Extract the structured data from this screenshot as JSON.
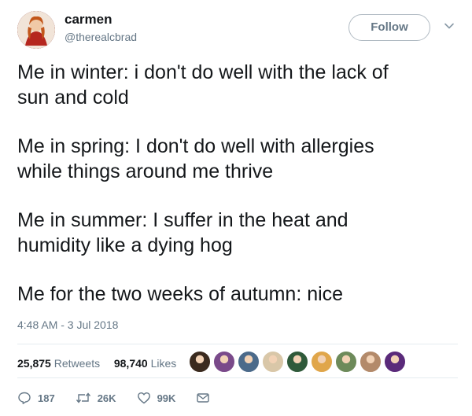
{
  "user": {
    "display_name": "carmen",
    "handle": "@therealcbrad",
    "follow_label": "Follow"
  },
  "tweet": {
    "lines": [
      "Me in winter: i don't do well with the lack of\nsun and cold",
      "Me in spring: I don't do well with allergies\nwhile things around me thrive",
      "Me in summer: I suffer in the heat and\nhumidity like a dying hog",
      "Me for the two weeks of autumn: nice"
    ],
    "timestamp": "4:48 AM - 3 Jul 2018"
  },
  "stats": {
    "retweets_count": "25,875",
    "retweets_label": "Retweets",
    "likes_count": "98,740",
    "likes_label": "Likes"
  },
  "liker_avatar_colors": [
    "#3a2a1e",
    "#7a4a8a",
    "#4b6a8a",
    "#d9c7a8",
    "#2f5a3a",
    "#e0a64a",
    "#6d8a5a",
    "#b38a6a",
    "#5a2a7a"
  ],
  "actions": {
    "reply_count": "187",
    "retweet_count": "26K",
    "like_count": "99K"
  },
  "icons": {
    "reply": "reply-icon",
    "retweet": "retweet-icon",
    "like": "heart-icon",
    "message": "envelope-icon",
    "more": "chevron-down-icon"
  }
}
